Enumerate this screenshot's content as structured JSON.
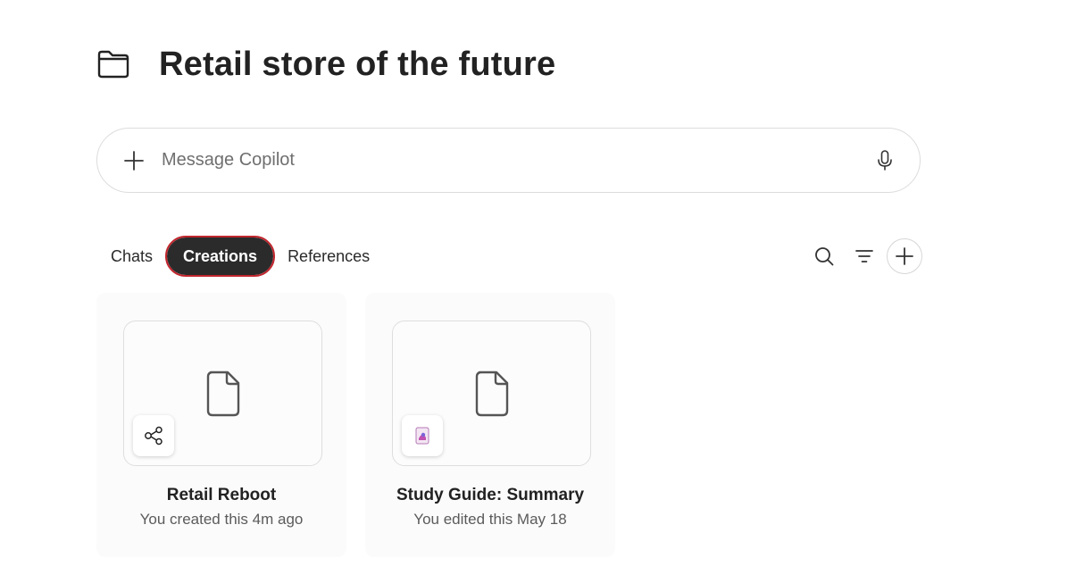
{
  "header": {
    "title": "Retail store of the future",
    "icon": "folder-icon"
  },
  "composer": {
    "placeholder": "Message Copilot",
    "value": "",
    "add_icon": "plus-icon",
    "mic_icon": "microphone-icon"
  },
  "tabs": [
    {
      "label": "Chats",
      "active": false
    },
    {
      "label": "Creations",
      "active": true
    },
    {
      "label": "References",
      "active": false
    }
  ],
  "toolbar": {
    "search_icon": "search-icon",
    "filter_icon": "filter-icon",
    "add_icon": "plus-icon"
  },
  "cards": [
    {
      "title": "Retail Reboot",
      "subtitle": "You created this 4m ago",
      "thumb_icon": "document-icon",
      "badge_icon": "share-nodes-icon"
    },
    {
      "title": "Study Guide: Summary",
      "subtitle": "You edited this May 18",
      "thumb_icon": "document-icon",
      "badge_icon": "pages-app-icon"
    }
  ],
  "colors": {
    "active_tab_bg": "#2b2b2b",
    "active_tab_outline": "#c0262d",
    "card_bg": "#fbfbfb"
  }
}
